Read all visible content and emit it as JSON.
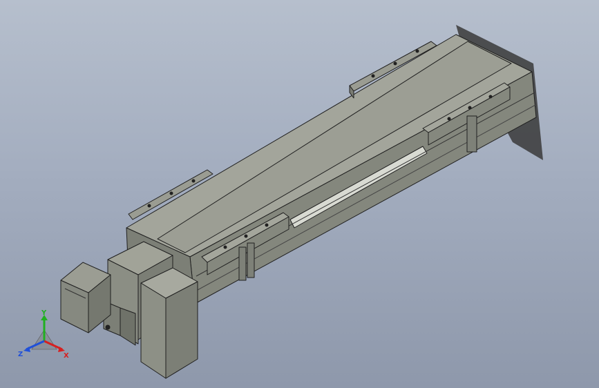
{
  "viewport": {
    "scene": "isometric-3d-model",
    "background_top": "#b6bfcd",
    "background_bottom": "#8e98ab",
    "part_color": "#8f9288",
    "edge_color": "#1e1e1e",
    "shadow_color": "#2a2a2a"
  },
  "triad": {
    "x_label": "X",
    "y_label": "Y",
    "z_label": "Z",
    "x_color": "#d62020",
    "y_color": "#20b020",
    "z_color": "#2050d8"
  }
}
